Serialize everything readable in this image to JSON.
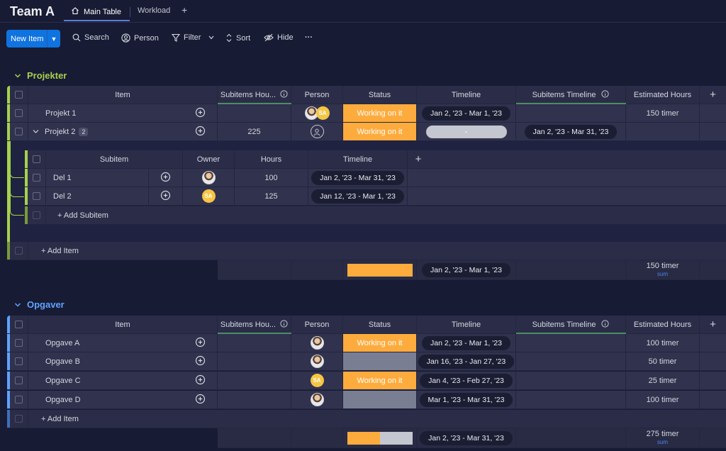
{
  "header": {
    "board_title": "Team A",
    "tabs": [
      {
        "label": "Main Table",
        "active": true
      },
      {
        "label": "Workload",
        "active": false
      }
    ],
    "add_tab": "+"
  },
  "toolbar": {
    "new_item": "New Item",
    "search": "Search",
    "person": "Person",
    "filter": "Filter",
    "sort": "Sort",
    "hide": "Hide",
    "more": "···"
  },
  "columns": {
    "item": "Item",
    "subitems_hours": "Subitems Hou...",
    "person": "Person",
    "status": "Status",
    "timeline": "Timeline",
    "subitems_timeline": "Subitems Timeline",
    "estimated_hours": "Estimated Hours",
    "add": "+"
  },
  "group1": {
    "name": "Projekter",
    "color": "#a7d14d",
    "rows": [
      {
        "item": "Projekt 1",
        "subitems_hours": "",
        "status": "Working on it",
        "timeline": "Jan 2, '23 - Mar 1, '23",
        "subitems_timeline": "",
        "estimated_hours": "150 timer"
      },
      {
        "item": "Projekt 2",
        "badge": "2",
        "subitems_hours": "225",
        "status": "Working on it",
        "timeline": "-",
        "subitems_timeline": "Jan 2, '23 - Mar 31, '23",
        "estimated_hours": ""
      }
    ],
    "subitems": {
      "columns": {
        "subitem": "Subitem",
        "owner": "Owner",
        "hours": "Hours",
        "timeline": "Timeline",
        "add": "+"
      },
      "rows": [
        {
          "name": "Del 1",
          "owner": "",
          "hours": "100",
          "timeline": "Jan 2, '23 - Mar 31, '23"
        },
        {
          "name": "Del 2",
          "owner": "SA",
          "hours": "125",
          "timeline": "Jan 12, '23 - Mar 1, '23"
        }
      ],
      "add_label": "+ Add Subitem"
    },
    "add_item": "+ Add Item",
    "summary": {
      "timeline": "Jan 2, '23 - Mar 1, '23",
      "estimated": "150 timer",
      "estimated_label": "sum",
      "status_working_fraction": 1.0
    }
  },
  "group2": {
    "name": "Opgaver",
    "color": "#5ea3ff",
    "rows": [
      {
        "item": "Opgave A",
        "person": "photo",
        "status": "Working on it",
        "timeline": "Jan 2, '23 - Mar 1, '23",
        "estimated_hours": "100 timer"
      },
      {
        "item": "Opgave B",
        "person": "photo",
        "status": "",
        "timeline": "Jan 16, '23 - Jan 27, '23",
        "estimated_hours": "50 timer"
      },
      {
        "item": "Opgave C",
        "person": "SA",
        "status": "Working on it",
        "timeline": "Jan 4, '23 - Feb 27, '23",
        "estimated_hours": "25 timer"
      },
      {
        "item": "Opgave D",
        "person": "photo",
        "status": "",
        "timeline": "Mar 1, '23 - Mar 31, '23",
        "estimated_hours": "100 timer"
      }
    ],
    "add_item": "+ Add Item",
    "summary": {
      "timeline": "Jan 2, '23 - Mar 31, '23",
      "estimated": "275 timer",
      "estimated_label": "sum",
      "status_working_fraction": 0.5
    }
  },
  "avatar_initials": "SA",
  "colors": {
    "working": "#fdab3d",
    "empty_status": "#797e93",
    "accent": "#0f73e0"
  }
}
